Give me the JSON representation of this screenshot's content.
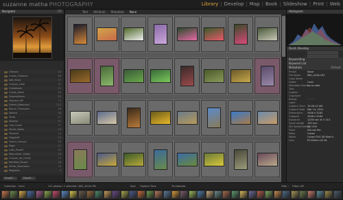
{
  "app": {
    "brand_name": "suzanne matha",
    "brand_suffix": "PHOTOGRAPHY",
    "modules": [
      "Library",
      "Develop",
      "Map",
      "Book",
      "Slideshow",
      "Print",
      "Web"
    ],
    "active_module": "Library",
    "accent": "#e8a63c"
  },
  "left_panel": {
    "navigator_label": "Navigator",
    "navigator_zoom": "FIT",
    "folders": [
      {
        "name": "Orleans",
        "count": "42"
      },
      {
        "name": "Ocean_Gardens",
        "count": "88"
      },
      {
        "name": "Salt_River",
        "count": "27"
      },
      {
        "name": "Canyon_Lake",
        "count": "31"
      },
      {
        "name": "Camelback",
        "count": "19"
      },
      {
        "name": "Cholla_Wash",
        "count": "64"
      },
      {
        "name": "Superstitions",
        "count": "55"
      },
      {
        "name": "Saguaro_NP",
        "count": "73"
      },
      {
        "name": "Desert_Botanical",
        "count": "112"
      },
      {
        "name": "Boyce_Thompson",
        "count": "46"
      },
      {
        "name": "Sabino",
        "count": "38"
      },
      {
        "name": "Tonto",
        "count": "22"
      },
      {
        "name": "Sedona",
        "count": "91"
      },
      {
        "name": "Oak_Creek",
        "count": "17"
      },
      {
        "name": "Verde_Valley",
        "count": "29"
      },
      {
        "name": "Prescott",
        "count": "14"
      },
      {
        "name": "Flagstaff",
        "count": "33"
      },
      {
        "name": "Grand_Canyon",
        "count": "58"
      },
      {
        "name": "Page",
        "count": "21"
      },
      {
        "name": "Lake_Powell",
        "count": "40"
      },
      {
        "name": "Monument_Valley",
        "count": "26"
      },
      {
        "name": "Canyon_de_Chelly",
        "count": "12"
      },
      {
        "name": "Petrified_Forest",
        "count": "18"
      },
      {
        "name": "White_Mountains",
        "count": "35"
      },
      {
        "name": "Mogollon",
        "count": "9"
      }
    ],
    "import_label": "Import...",
    "export_label": "Export..."
  },
  "grid": {
    "filter_labels": [
      "Text",
      "Attribute",
      "Metadata",
      "None"
    ],
    "filter_active": "None"
  },
  "right_panel": {
    "histogram_label": "Histogram",
    "quick_develop_label": "Quick Develop",
    "keywording_label": "Keywording",
    "keyword_list_label": "Keyword List",
    "metadata_label": "Metadata",
    "metadata_preset": "Default",
    "metadata_rows": [
      {
        "label": "Preset",
        "value": "None"
      },
      {
        "label": "File Name",
        "value": "IMG_4418.CR2"
      },
      {
        "label": "Copy Name",
        "value": ""
      },
      {
        "label": "Folder",
        "value": "Cacti"
      },
      {
        "label": "Metadata Status",
        "value": "Up to date"
      },
      {
        "label": "Title",
        "value": ""
      },
      {
        "label": "Caption",
        "value": ""
      },
      {
        "label": "Copyright",
        "value": ""
      },
      {
        "label": "Rating",
        "value": "· · · · ·"
      },
      {
        "label": "Label",
        "value": ""
      },
      {
        "label": "Capture Time",
        "value": "10:45:12 AM"
      },
      {
        "label": "Capture Date",
        "value": "Mar 14, 2012"
      },
      {
        "label": "Dimensions",
        "value": "3456 x 5184"
      },
      {
        "label": "Cropped",
        "value": "3456 x 5184"
      },
      {
        "label": "Exposure",
        "value": "1/250 sec at f / 8.0"
      },
      {
        "label": "Focal Length",
        "value": "100 mm"
      },
      {
        "label": "ISO Speed Rating",
        "value": "ISO 200"
      },
      {
        "label": "Flash",
        "value": "Did not fire"
      },
      {
        "label": "Make",
        "value": "Canon"
      },
      {
        "label": "Model",
        "value": "Canon EOS 5D Mark II"
      },
      {
        "label": "Lens",
        "value": "EF100mm f/2.8L"
      }
    ],
    "sync_label": "Sync",
    "sync_settings_label": "Sync Settings"
  },
  "toolbar": {
    "sort_label": "Sort:",
    "sort_value": "Capture Time",
    "thumbnails_label": "Thumbnails",
    "collection_label": "Collection : Cacti",
    "photo_count": "111 photos / 1 selected / IMG_4418.CR2",
    "filter_label": "Filter :",
    "filter_value": "Filters Off"
  }
}
